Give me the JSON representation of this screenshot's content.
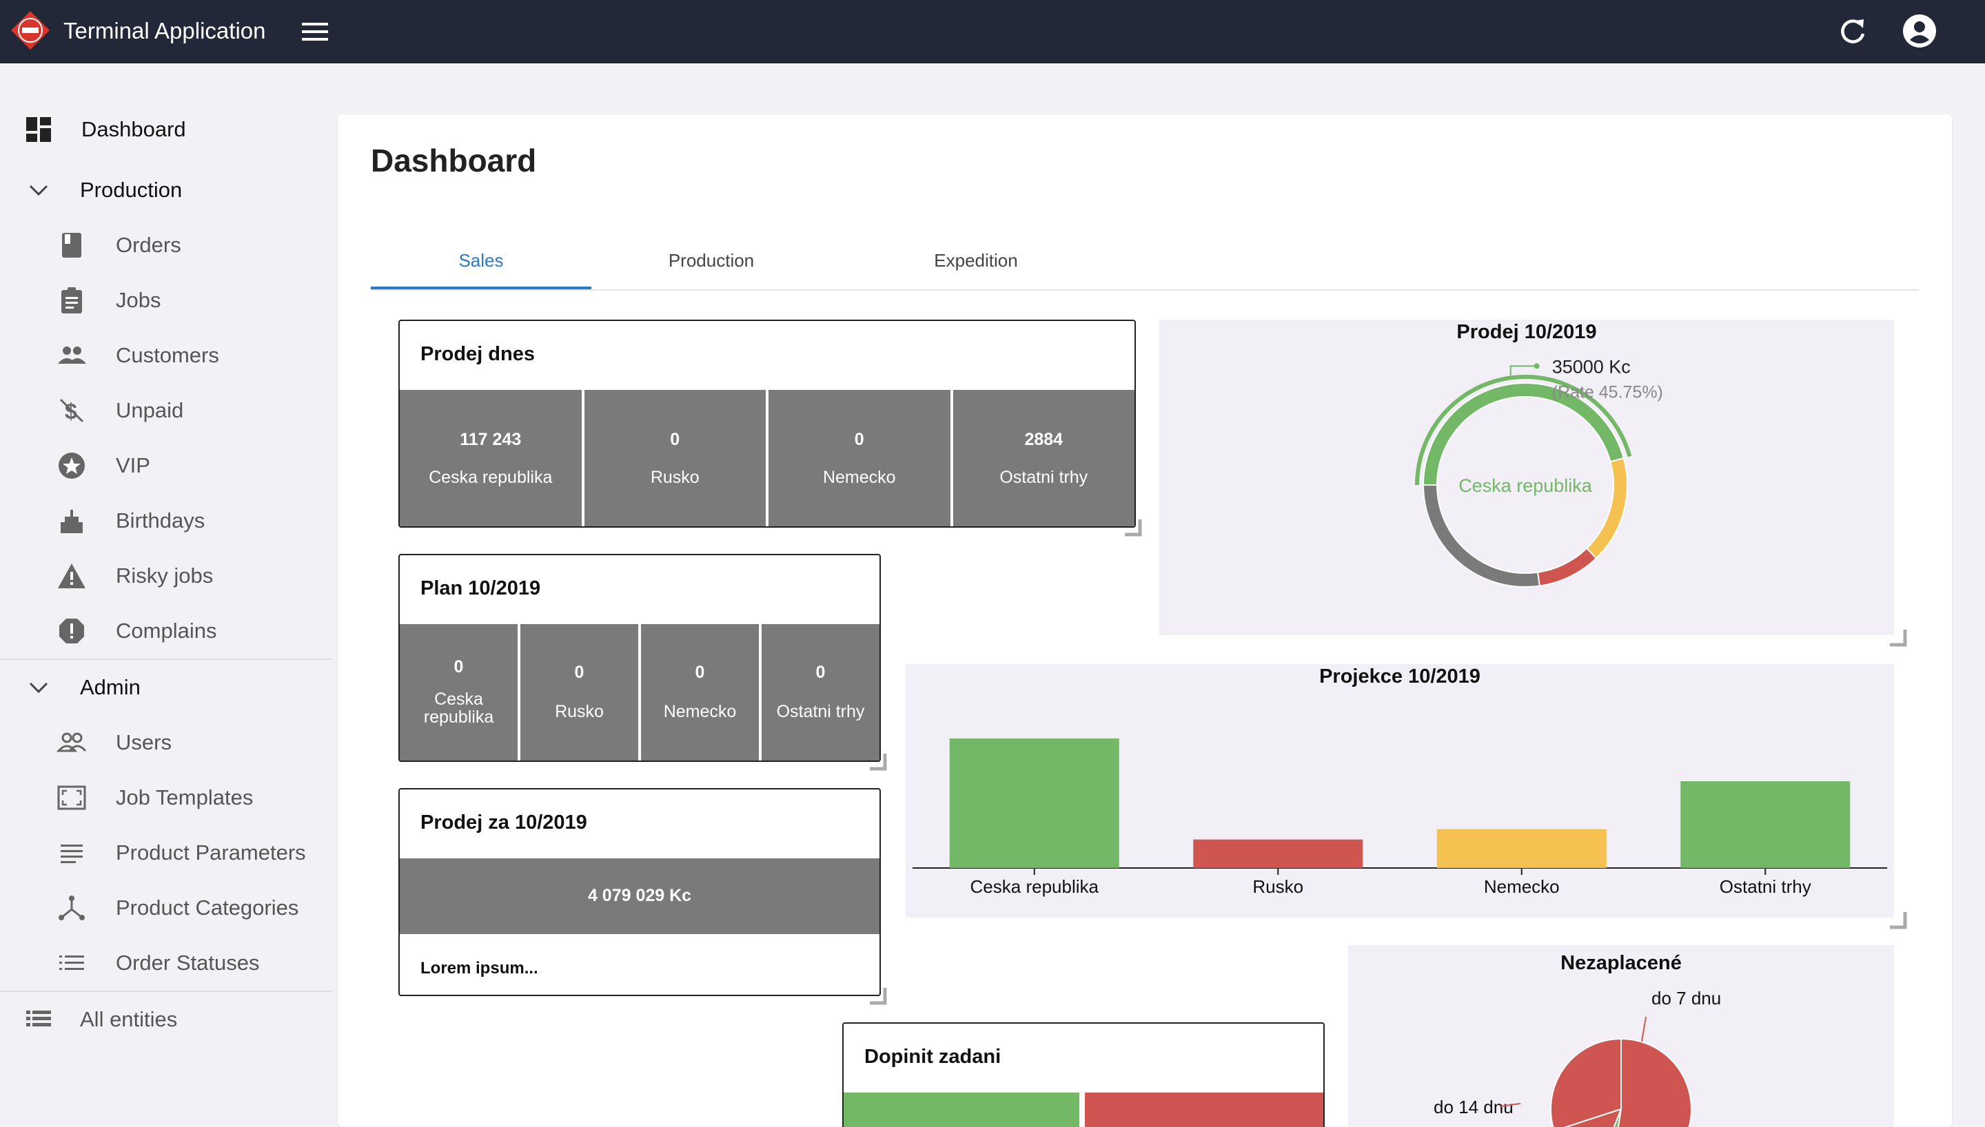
{
  "app": {
    "title": "Terminal Application"
  },
  "colors": {
    "appbar": "#232838",
    "accent": "#2a78c8",
    "green": "#72b866",
    "red": "#cf5650",
    "yellow": "#f5c150",
    "gray": "#7a7a7a"
  },
  "sidebar": {
    "dashboard": "Dashboard",
    "production": {
      "label": "Production",
      "items": [
        "Orders",
        "Jobs",
        "Customers",
        "Unpaid",
        "VIP",
        "Birthdays",
        "Risky jobs",
        "Complains"
      ]
    },
    "admin": {
      "label": "Admin",
      "items": [
        "Users",
        "Job Templates",
        "Product Parameters",
        "Product Categories",
        "Order Statuses"
      ]
    },
    "all_entities": "All entities"
  },
  "page": {
    "title": "Dashboard"
  },
  "tabs": [
    "Sales",
    "Production",
    "Expedition"
  ],
  "widgets": {
    "prodej_dnes": {
      "title": "Prodej dnes",
      "stats": [
        {
          "value": "117 243",
          "label": "Ceska republika"
        },
        {
          "value": "0",
          "label": "Rusko"
        },
        {
          "value": "0",
          "label": "Nemecko"
        },
        {
          "value": "2884",
          "label": "Ostatni trhy"
        }
      ]
    },
    "plan": {
      "title": "Plan 10/2019",
      "stats": [
        {
          "value": "0",
          "label": "Ceska republika"
        },
        {
          "value": "0",
          "label": "Rusko"
        },
        {
          "value": "0",
          "label": "Nemecko"
        },
        {
          "value": "0",
          "label": "Ostatni trhy"
        }
      ]
    },
    "prodej_za": {
      "title": "Prodej za 10/2019",
      "total": "4 079 029 Kc",
      "note": "Lorem ipsum..."
    },
    "dopinit": {
      "title": "Dopinit zadani"
    }
  },
  "chart_data": [
    {
      "type": "pie",
      "variant": "donut",
      "title": "Prodej 10/2019",
      "categories": [
        "Ceska republika",
        "Nemecko",
        "Rusko",
        "Ostatni trhy"
      ],
      "values": [
        45.75,
        17,
        10,
        27.25
      ],
      "active": {
        "label": "Ceska republika",
        "value": "35000 Kc",
        "rate": "(Rate 45.75%)"
      }
    },
    {
      "type": "bar",
      "title": "Projekce 10/2019",
      "categories": [
        "Ceska republika",
        "Rusko",
        "Nemecko",
        "Ostatni trhy"
      ],
      "values": [
        100,
        22,
        30,
        67
      ],
      "ylim": [
        0,
        100
      ]
    },
    {
      "type": "pie",
      "title": "Nezaplacené",
      "categories": [
        "do 7 dnu",
        "do 14 dnu"
      ],
      "values": [
        70,
        30
      ]
    }
  ]
}
